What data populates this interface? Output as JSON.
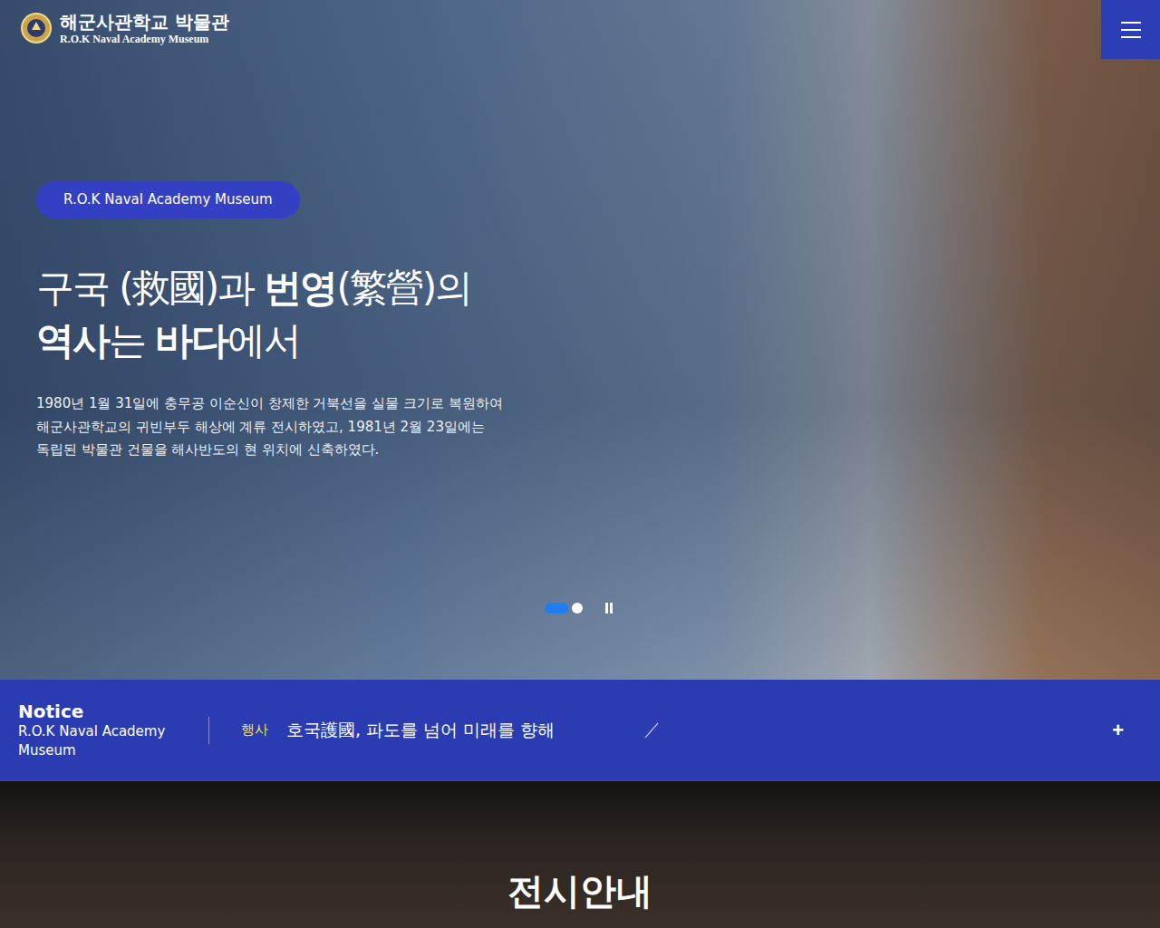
{
  "header": {
    "logo_title": "해군사관학교 박물관",
    "logo_subtitle": "R.O.K Naval Academy Museum"
  },
  "hero": {
    "badge": "R.O.K Naval Academy Museum",
    "headline": [
      [
        {
          "text": "구국 (救國)과 ",
          "bold": false
        },
        {
          "text": "번영",
          "bold": true
        },
        {
          "text": "(繁營)의",
          "bold": false
        }
      ],
      [
        {
          "text": "역사",
          "bold": true
        },
        {
          "text": "는 ",
          "bold": false
        },
        {
          "text": "바다",
          "bold": true
        },
        {
          "text": "에서",
          "bold": false
        }
      ]
    ],
    "description": [
      "1980년 1월 31일에 충무공 이순신이 창제한 거북선을 실물 크기로 복원하여",
      "해군사관학교의 귀빈부두 해상에 계류 전시하였고, 1981년 2월 23일에는",
      "독립된 박물관 건물을 해사반도의 현 위치에 신축하였다."
    ],
    "slides": [
      {
        "selected": true
      },
      {
        "selected": false
      }
    ],
    "paused": false
  },
  "notice": {
    "title": "Notice",
    "subtitle": "R.O.K Naval Academy Museum",
    "items": [
      {
        "category": "행사",
        "text": "호국護國, 파도를 넘어 미래를 향해"
      }
    ],
    "more": "+"
  },
  "exhibit": {
    "title": "전시안내"
  }
}
